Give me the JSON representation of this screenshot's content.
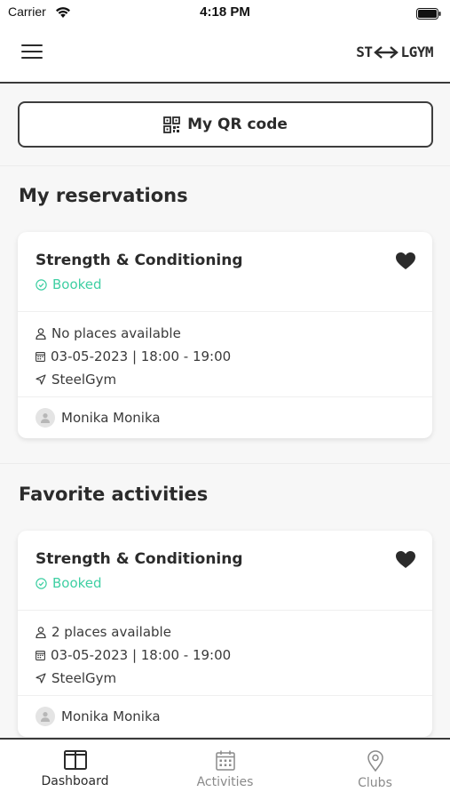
{
  "status_bar": {
    "carrier": "Carrier",
    "time": "4:18 PM"
  },
  "header": {
    "menu_icon": "hamburger-icon",
    "logo_left": "ST",
    "logo_right": "LGYM"
  },
  "qr": {
    "label": "My QR code",
    "icon": "qr-code-icon"
  },
  "reservations": {
    "title": "My reservations",
    "card": {
      "name": "Strength & Conditioning",
      "status": "Booked",
      "availability": "No places available",
      "datetime": "03-05-2023 | 18:00 - 19:00",
      "club": "SteelGym",
      "member": "Monika Monika"
    }
  },
  "favorites": {
    "title": "Favorite activities",
    "card": {
      "name": "Strength & Conditioning",
      "status": "Booked",
      "availability": "2 places available",
      "datetime": "03-05-2023 | 18:00 - 19:00",
      "club": "SteelGym",
      "member": "Monika Monika"
    }
  },
  "tabs": [
    {
      "label": "Dashboard",
      "icon": "dashboard-icon",
      "active": true
    },
    {
      "label": "Activities",
      "icon": "calendar-icon",
      "active": false
    },
    {
      "label": "Clubs",
      "icon": "location-pin-icon",
      "active": false
    }
  ],
  "colors": {
    "accent": "#3fcfa3",
    "text": "#2b2b2b",
    "muted": "#8a8a8a",
    "background": "#f7f7f7"
  }
}
